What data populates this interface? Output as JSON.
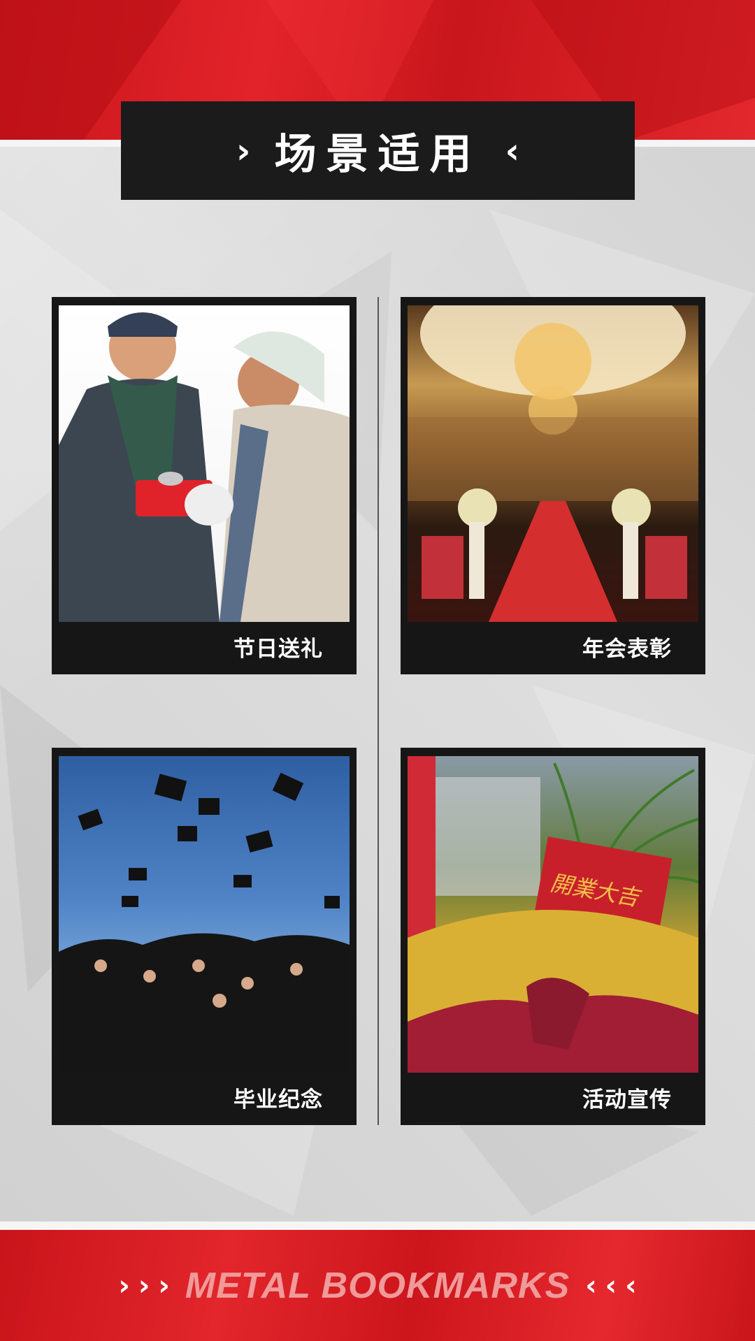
{
  "header": {
    "title": "场景适用",
    "left_icon": "chevron-right-icon",
    "right_icon": "chevron-left-icon"
  },
  "scenes": [
    {
      "caption": "节日送礼",
      "photo": "couple exchanging gift"
    },
    {
      "caption": "年会表彰",
      "photo": "banquet hall with red carpet"
    },
    {
      "caption": "毕业纪念",
      "photo": "graduates throwing caps"
    },
    {
      "caption": "活动宣传",
      "photo": "opening ceremony flower arrangement"
    }
  ],
  "photo_texts": {
    "opening_card": "開業大吉"
  },
  "footer": {
    "text": "METAL BOOKMARKS",
    "left_icons": "chevron-right-icon",
    "right_icons": "chevron-left-icon"
  },
  "colors": {
    "brand_red": "#d91c22",
    "panel_dark": "#161616",
    "background_gray": "#d8d8d8",
    "footer_text": "#f09a9a"
  }
}
